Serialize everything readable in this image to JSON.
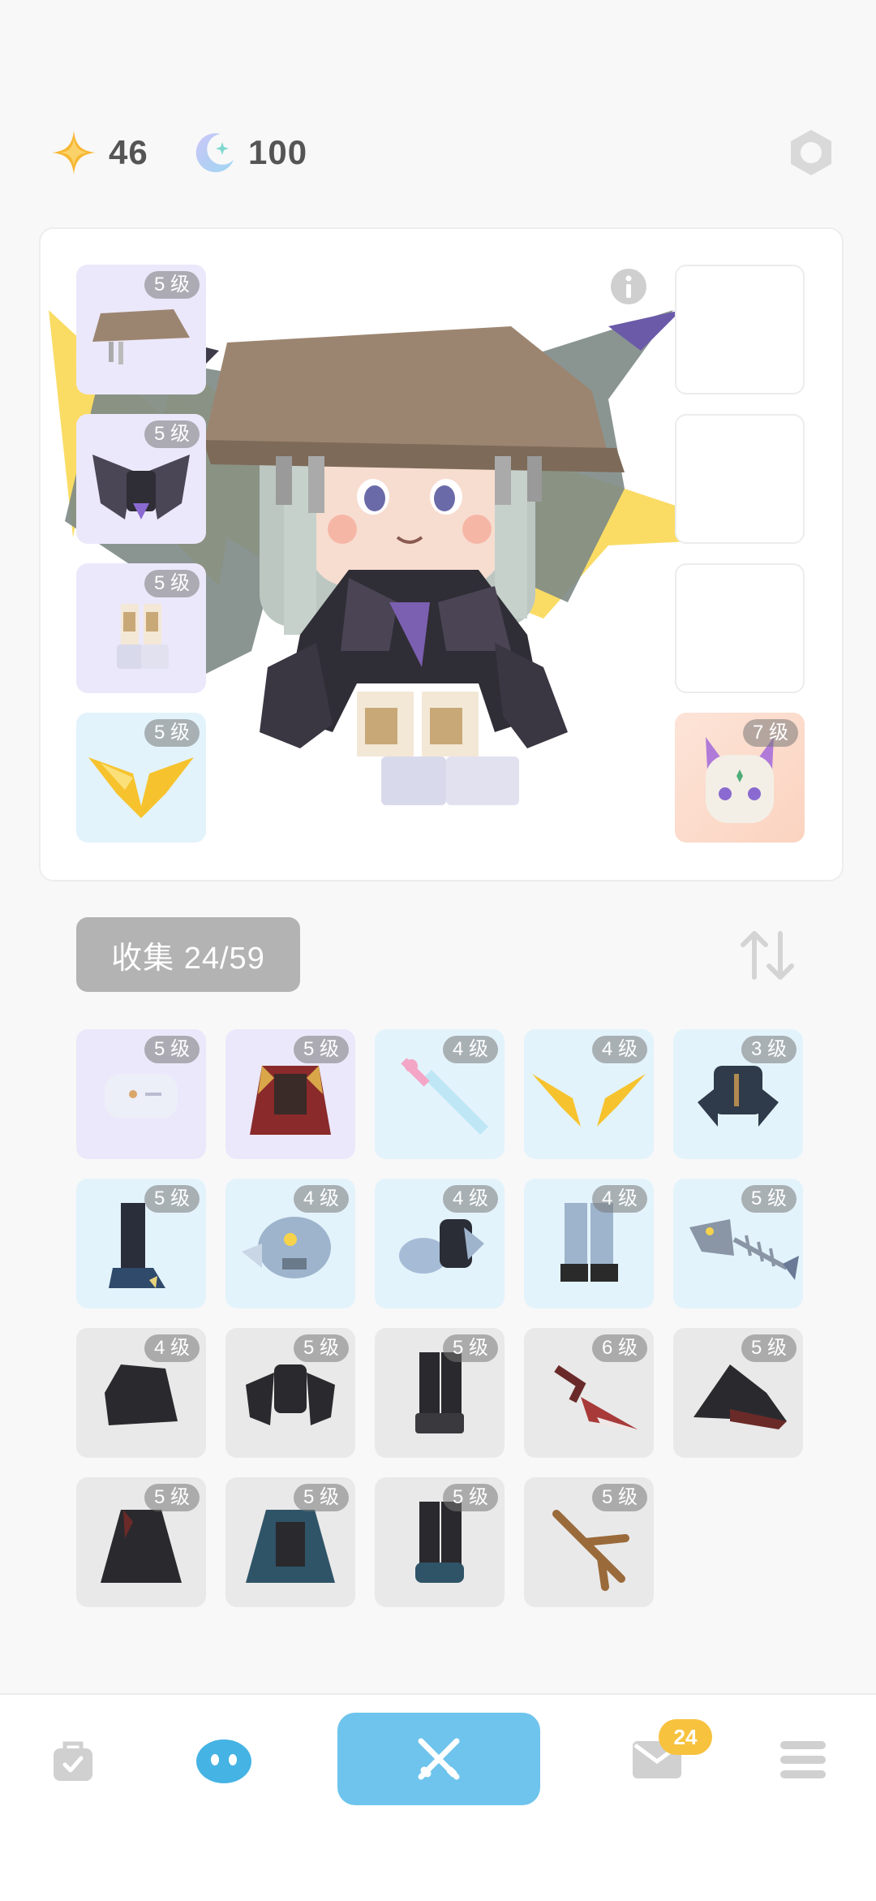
{
  "currency": {
    "stars": "46",
    "moons": "100"
  },
  "equipped_left": [
    {
      "name": "hat",
      "level": "5 级",
      "bg": "purple"
    },
    {
      "name": "wings",
      "level": "5 级",
      "bg": "purple"
    },
    {
      "name": "pants",
      "level": "5 级",
      "bg": "purple"
    },
    {
      "name": "back-item",
      "level": "5 级",
      "bg": "blue"
    }
  ],
  "equipped_right": [
    {
      "name": "empty-slot-1",
      "level": "",
      "bg": "empty"
    },
    {
      "name": "empty-slot-2",
      "level": "",
      "bg": "empty"
    },
    {
      "name": "empty-slot-3",
      "level": "",
      "bg": "empty"
    },
    {
      "name": "pet-cat",
      "level": "7 级",
      "bg": "peach"
    }
  ],
  "collection": {
    "label": "收集 24/59"
  },
  "inventory": [
    {
      "name": "white-jacket",
      "level": "5 级",
      "bg": "purple"
    },
    {
      "name": "red-cape",
      "level": "5 级",
      "bg": "purple"
    },
    {
      "name": "pink-sword",
      "level": "4 级",
      "bg": "blue"
    },
    {
      "name": "lightning-wings",
      "level": "4 级",
      "bg": "blue"
    },
    {
      "name": "dark-armor",
      "level": "3 级",
      "bg": "blue"
    },
    {
      "name": "claw-boots",
      "level": "5 级",
      "bg": "blue"
    },
    {
      "name": "fish-helmet",
      "level": "4 级",
      "bg": "blue"
    },
    {
      "name": "blue-sleeves",
      "level": "4 级",
      "bg": "blue"
    },
    {
      "name": "grey-pants",
      "level": "4 级",
      "bg": "blue"
    },
    {
      "name": "fish-bone",
      "level": "5 级",
      "bg": "blue"
    },
    {
      "name": "black-hood",
      "level": "4 级",
      "bg": "grey"
    },
    {
      "name": "black-armor",
      "level": "5 级",
      "bg": "grey"
    },
    {
      "name": "black-boots",
      "level": "5 级",
      "bg": "grey"
    },
    {
      "name": "dragon-blade",
      "level": "6 级",
      "bg": "grey"
    },
    {
      "name": "witch-hat",
      "level": "5 级",
      "bg": "grey"
    },
    {
      "name": "dark-robe",
      "level": "5 级",
      "bg": "grey"
    },
    {
      "name": "teal-cape",
      "level": "5 级",
      "bg": "grey"
    },
    {
      "name": "dark-shoes",
      "level": "5 级",
      "bg": "grey"
    },
    {
      "name": "wooden-branch",
      "level": "5 级",
      "bg": "grey"
    }
  ],
  "nav": {
    "mail_badge": "24"
  },
  "colors": {
    "accent": "#6ec4ec",
    "badge": "#f7c23e",
    "star": "#f7b733",
    "moon": "#b9b7f2"
  }
}
